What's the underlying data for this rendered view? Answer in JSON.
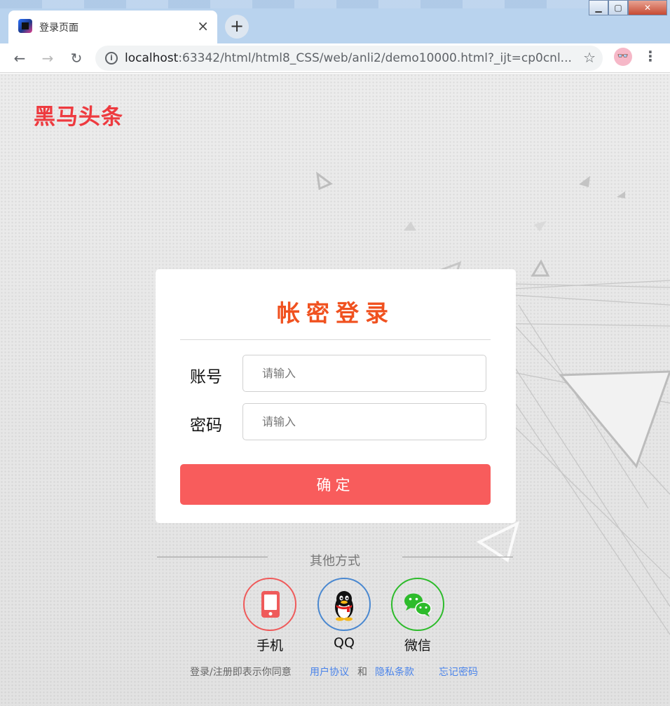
{
  "browser": {
    "tab_title": "登录页面",
    "tab_close": "×",
    "new_tab": "+",
    "url_host": "localhost",
    "url_rest": ":63342/html/html8_CSS/web/anli2/demo10000.html?_ijt=cp0cnl...",
    "window_buttons": [
      "▁",
      "▢",
      "✕"
    ],
    "nav": {
      "back": "←",
      "forward": "→",
      "reload": "↻"
    },
    "info_icon": "i",
    "star_icon": "☆",
    "profile_icon": "👓",
    "menu_icon": "⋮"
  },
  "page": {
    "logo": "黑马头条",
    "login": {
      "title": "帐密登录",
      "account_label": "账号",
      "account_placeholder": "请输入",
      "password_label": "密码",
      "password_placeholder": "请输入",
      "submit": "确定"
    },
    "other": {
      "title": "其他方式",
      "methods": [
        {
          "label": "手机",
          "icon": "phone-icon",
          "color": "#ef5a5a"
        },
        {
          "label": "QQ",
          "icon": "qq-penguin-icon",
          "color": "#4a88d0"
        },
        {
          "label": "微信",
          "icon": "wechat-icon",
          "color": "#2dbb2b"
        }
      ]
    },
    "footer": {
      "agree_text": "登录/注册即表示你同意",
      "user_agreement": "用户协议",
      "and": "和",
      "privacy": "隐私条款",
      "forgot": "忘记密码"
    }
  },
  "colors": {
    "brand_red": "#ee3a3f",
    "title_orange": "#f0511f",
    "button_red": "#f85c5c",
    "link_blue": "#4b84ea"
  }
}
